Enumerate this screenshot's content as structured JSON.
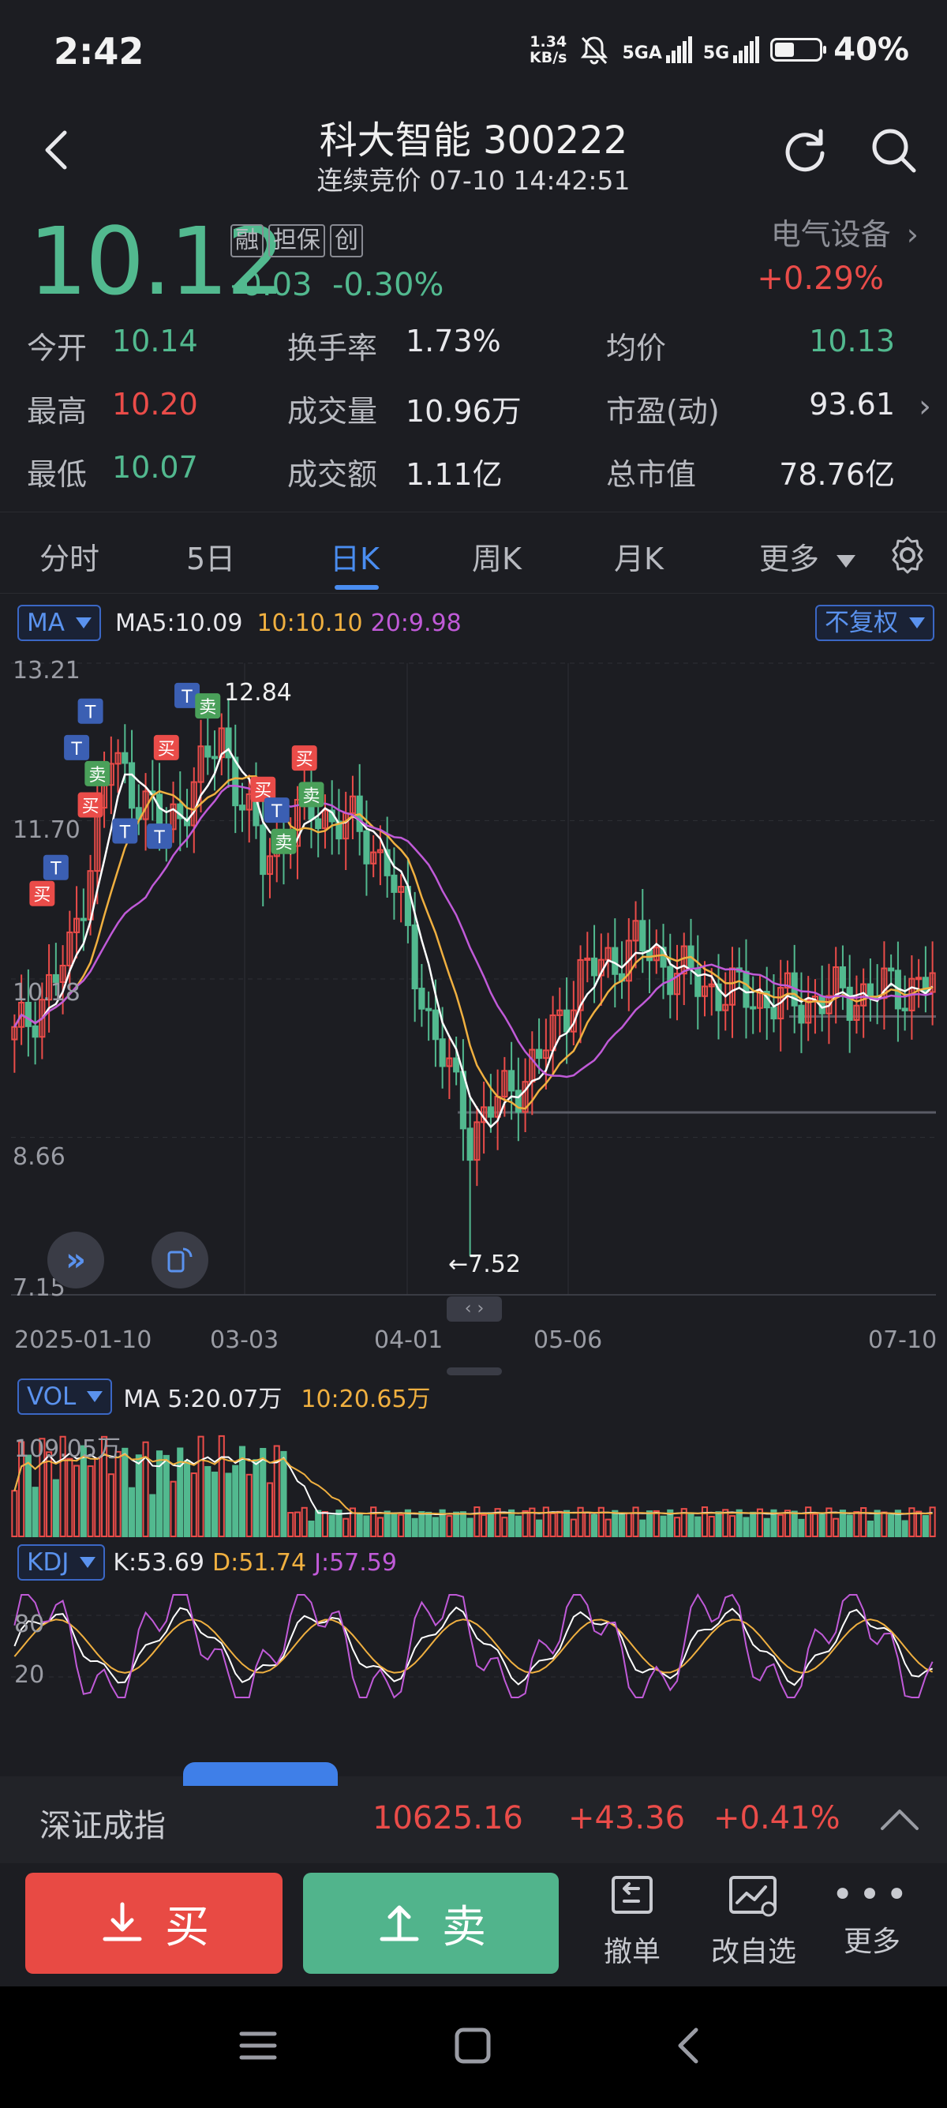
{
  "status_bar": {
    "time": "2:42",
    "net_speed_value": "1.34",
    "net_speed_unit": "KB/s",
    "sim1_label": "5GA",
    "sim2_label": "5G",
    "battery_pct": "40%"
  },
  "header": {
    "title": "科大智能 300222",
    "subtitle": "连续竞价 07-10 14:42:51"
  },
  "quote": {
    "price": "10.12",
    "tags": [
      "融",
      "担保",
      "创"
    ],
    "change": "-0.03",
    "change_pct": "-0.30%",
    "sector": "电气设备",
    "sector_change": "+0.29%",
    "open_label": "今开",
    "open": "10.14",
    "high_label": "最高",
    "high": "10.20",
    "low_label": "最低",
    "low": "10.07",
    "turnover_rate_label": "换手率",
    "turnover_rate": "1.73%",
    "volume_label": "成交量",
    "volume": "10.96万",
    "amount_label": "成交额",
    "amount": "1.11亿",
    "avg_label": "均价",
    "avg": "10.13",
    "pe_label": "市盈(动)",
    "pe": "93.61",
    "mktcap_label": "总市值",
    "mktcap": "78.76亿"
  },
  "tabs": [
    "分时",
    "5日",
    "日K",
    "周K",
    "月K",
    "更多"
  ],
  "active_tab": "日K",
  "indicators": {
    "ma_pill": "MA",
    "ma5": "MA5:10.09",
    "ma10": "10:10.10",
    "ma20": "20:9.98",
    "adjust": "不复权",
    "vol_pill": "VOL",
    "vol_ma5": "MA 5:20.07万",
    "vol_ma10": "10:20.65万",
    "vol_max": "109.05万",
    "kdj_pill": "KDJ",
    "kdj_k": "K:53.69",
    "kdj_d": "D:51.74",
    "kdj_j": "J:57.59"
  },
  "chart_data": {
    "type": "candlestick",
    "y_ticks": [
      "13.21",
      "11.70",
      "10.18",
      "8.66",
      "7.15"
    ],
    "ylim": [
      7.15,
      13.21
    ],
    "x_ticks": [
      "2025-01-10",
      "03-03",
      "04-01",
      "05-06",
      "07-10"
    ],
    "high_marker": "12.84",
    "low_marker": "←7.52",
    "kdj_ticks": [
      "80",
      "20"
    ],
    "trade_marks": [
      "买",
      "卖",
      "T"
    ],
    "colors": {
      "up": "#ea4c49",
      "down": "#52b98f",
      "ma5": "#ffffff",
      "ma10": "#f0b040",
      "ma20": "#c05ad8"
    }
  },
  "index_bar": {
    "name": "深证成指",
    "value": "10625.16",
    "change": "+43.36",
    "change_pct": "+0.41%"
  },
  "actions": {
    "buy": "买",
    "sell": "卖",
    "cancel": "撤单",
    "watchlist": "改自选",
    "more": "更多"
  }
}
